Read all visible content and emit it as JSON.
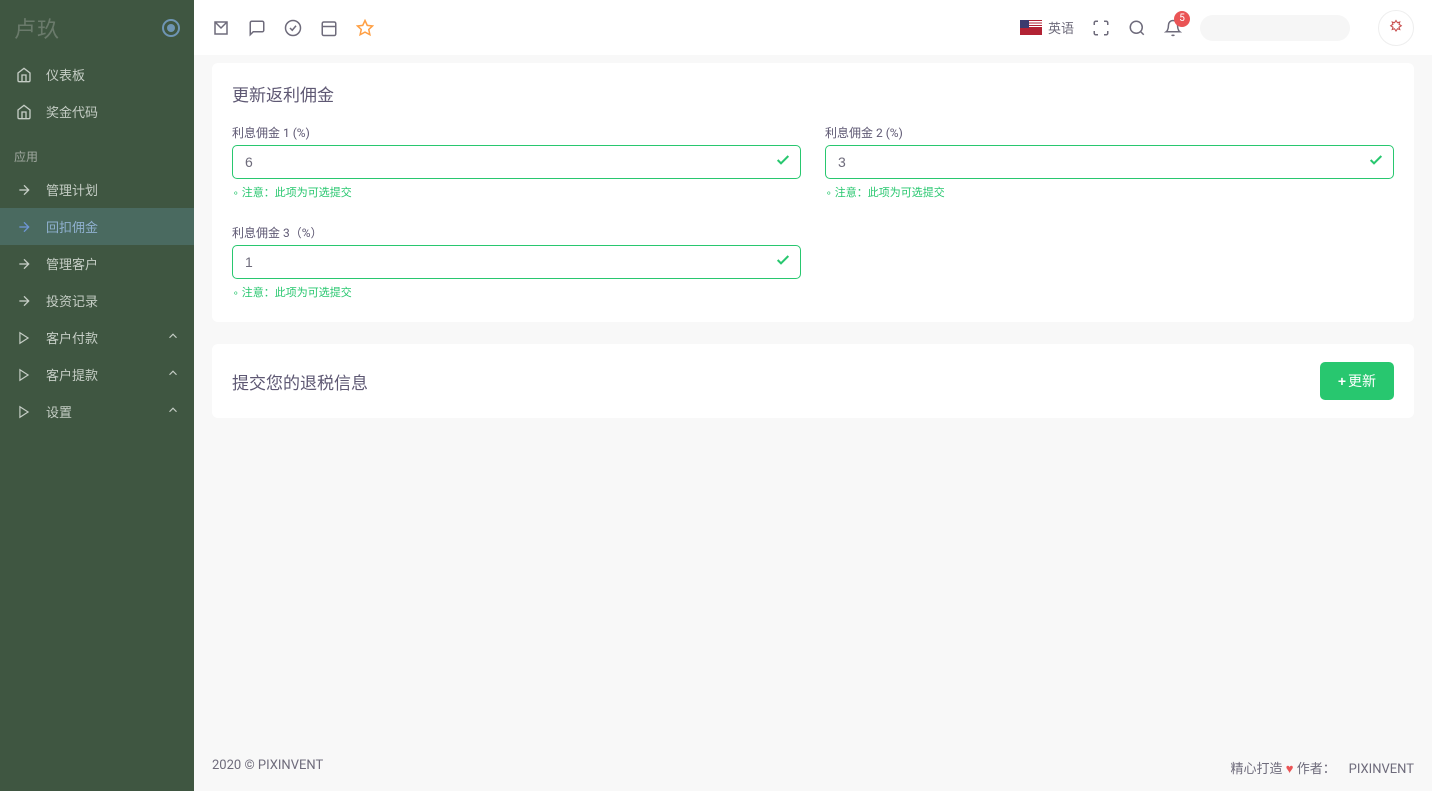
{
  "brand": "卢玖",
  "sidebar": {
    "items_top": [
      {
        "label": "仪表板",
        "icon": "home"
      },
      {
        "label": "奖金代码",
        "icon": "home"
      }
    ],
    "section_label": "应用",
    "items_app": [
      {
        "label": "管理计划",
        "icon": "arrow"
      },
      {
        "label": "回扣佣金",
        "icon": "arrow",
        "active": true
      },
      {
        "label": "管理客户",
        "icon": "arrow"
      },
      {
        "label": "投资记录",
        "icon": "arrow"
      },
      {
        "label": "客户付款",
        "icon": "play",
        "expandable": true
      },
      {
        "label": "客户提款",
        "icon": "play",
        "expandable": true
      },
      {
        "label": "设置",
        "icon": "play",
        "expandable": true
      }
    ]
  },
  "topbar": {
    "lang_label": "英语",
    "notification_count": "5"
  },
  "card1": {
    "title": "更新返利佣金",
    "fields": [
      {
        "label": "利息佣金 1 (%)",
        "value": "6",
        "help": "注意：此项为可选提交"
      },
      {
        "label": "利息佣金 2 (%)",
        "value": "3",
        "help": "注意：此项为可选提交"
      },
      {
        "label": "利息佣金 3（%）",
        "value": "1",
        "help": "注意：此项为可选提交"
      }
    ]
  },
  "card2": {
    "title": "提交您的退税信息",
    "button_label": "更新"
  },
  "footer": {
    "left": "2020 © PIXINVENT",
    "right_prefix": "精心打造",
    "right_author_label": "作者：",
    "right_author": "PIXINVENT"
  }
}
